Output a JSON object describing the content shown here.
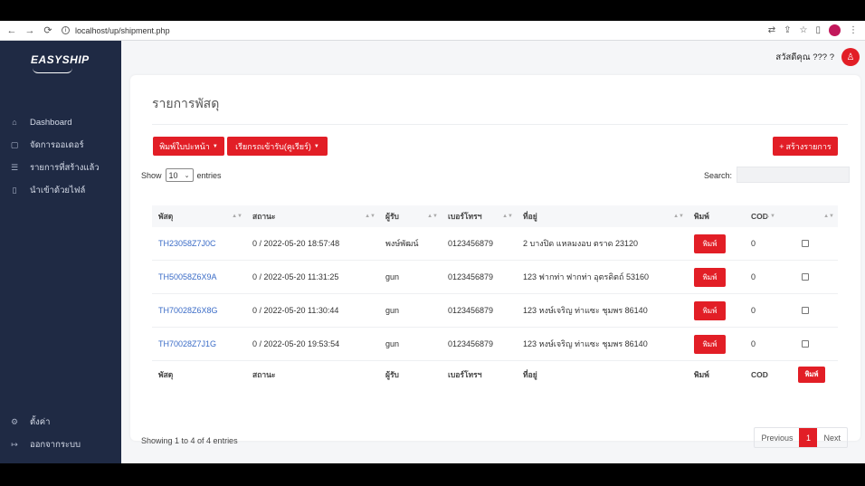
{
  "browser": {
    "url": "localhost/up/shipment.php",
    "back": "←",
    "forward": "→",
    "reload": "⟳"
  },
  "brand": {
    "logo_text": "EASYSHIP"
  },
  "sidebar": {
    "items": [
      {
        "label": "Dashboard",
        "icon": "home-icon"
      },
      {
        "label": "จัดการออเดอร์",
        "icon": "clipboard-icon"
      },
      {
        "label": "รายการที่สร้างแล้ว",
        "icon": "list-icon"
      },
      {
        "label": "นำเข้าด้วยไฟล์",
        "icon": "file-icon"
      },
      {
        "label": "ตั้งค่า",
        "icon": "gear-icon"
      },
      {
        "label": "ออกจากระบบ",
        "icon": "logout-icon"
      }
    ]
  },
  "header": {
    "greeting": "สวัสดีคุณ ??? ?"
  },
  "page": {
    "title": "รายการพัสดุ",
    "print_label_button": "พิมพ์ใบปะหน้า",
    "call_courier_button": "เรียกรถเข้ารับ(คูเรียร์)",
    "create_button": "สร้างรายการ",
    "show_label": "Show",
    "entries_label": "entries",
    "page_length": "10",
    "search_label": "Search:"
  },
  "table": {
    "columns": [
      "พัสดุ",
      "สถานะ",
      "ผู้รับ",
      "เบอร์โทรฯ",
      "ที่อยู่",
      "พิมพ์",
      "COD",
      ""
    ],
    "rows": [
      {
        "tracking": "TH23058Z7J0C",
        "status": "0 / 2022-05-20 18:57:48",
        "recipient": "พงษ์พัฒน์",
        "phone": "0123456879",
        "address": "2 บางปิด แหลมงอบ ตราด 23120",
        "print": "พิมพ์",
        "cod": "0"
      },
      {
        "tracking": "TH50058Z6X9A",
        "status": "0 / 2022-05-20 11:31:25",
        "recipient": "gun",
        "phone": "0123456879",
        "address": "123 ฟากท่า ฟากท่า อุตรดิตถ์ 53160",
        "print": "พิมพ์",
        "cod": "0"
      },
      {
        "tracking": "TH70028Z6X8G",
        "status": "0 / 2022-05-20 11:30:44",
        "recipient": "gun",
        "phone": "0123456879",
        "address": "123 หงษ์เจริญ ท่าแซะ ชุมพร 86140",
        "print": "พิมพ์",
        "cod": "0"
      },
      {
        "tracking": "TH70028Z7J1G",
        "status": "0 / 2022-05-20 19:53:54",
        "recipient": "gun",
        "phone": "0123456879",
        "address": "123 หงษ์เจริญ ท่าแซะ ชุมพร 86140",
        "print": "พิมพ์",
        "cod": "0"
      }
    ],
    "footer": [
      "พัสดุ",
      "สถานะ",
      "ผู้รับ",
      "เบอร์โทรฯ",
      "ที่อยู่",
      "พิมพ์",
      "COD"
    ],
    "footer_print_button": "พิมพ์"
  },
  "pagination": {
    "info": "Showing 1 to 4 of 4 entries",
    "previous": "Previous",
    "current": "1",
    "next": "Next"
  },
  "colors": {
    "accent": "#e21e26",
    "sidebar": "#1f2a44",
    "link": "#3b6cc7"
  }
}
